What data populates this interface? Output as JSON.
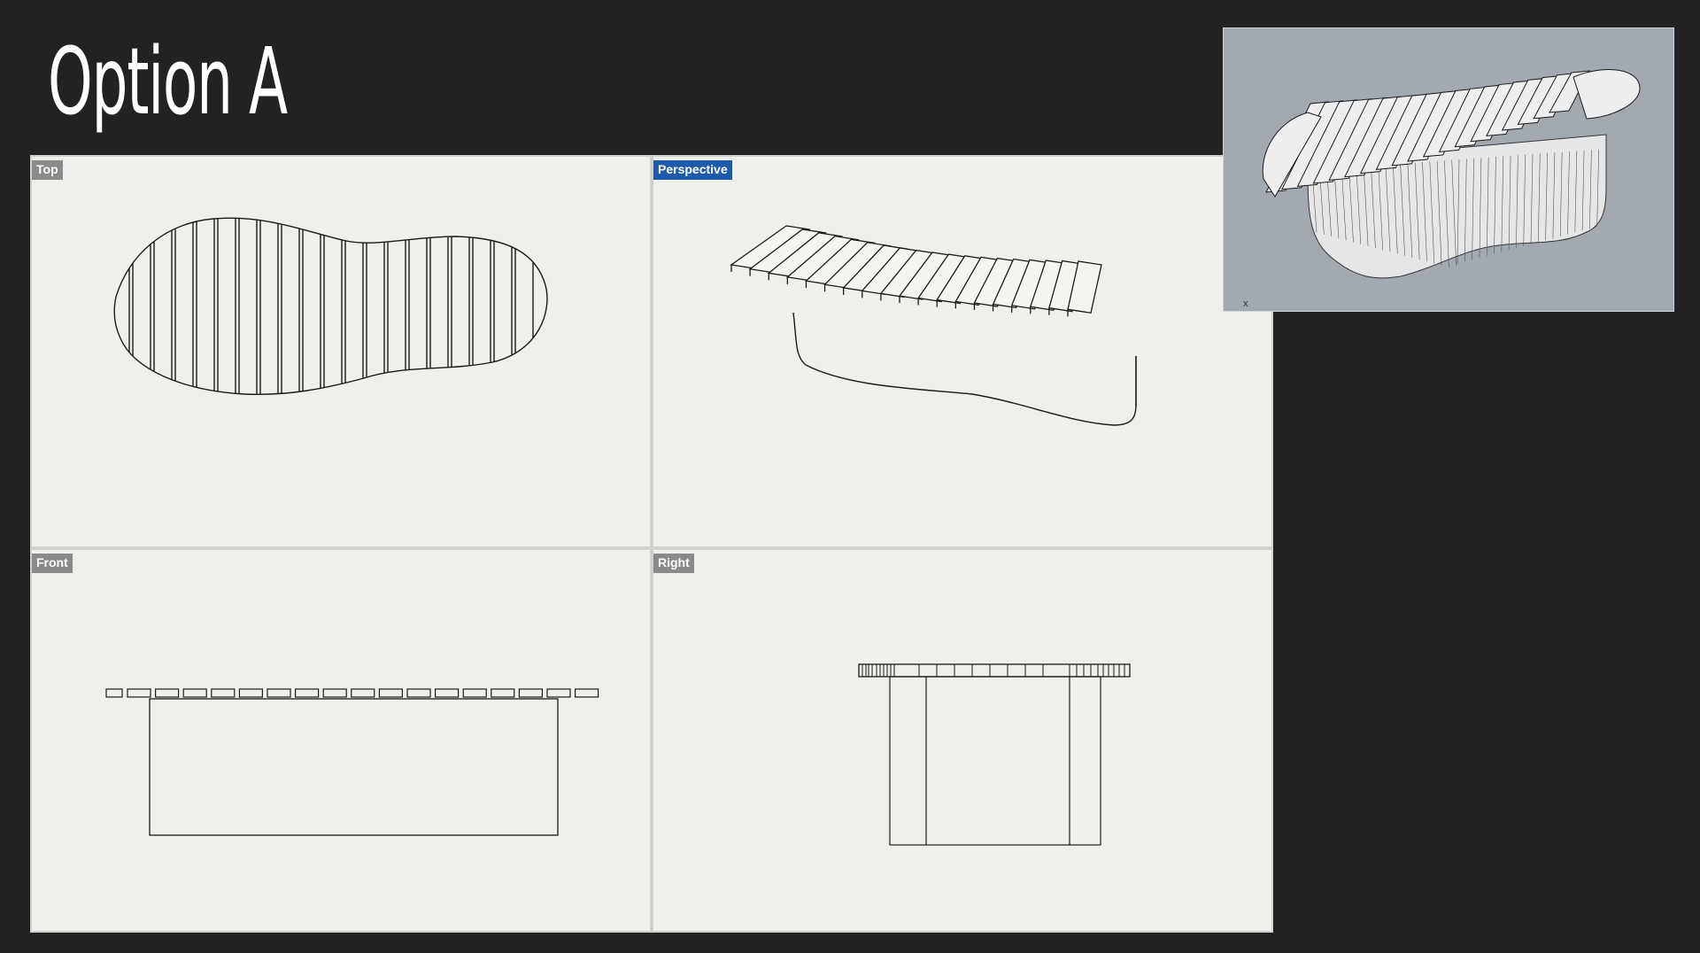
{
  "slide": {
    "title": "Option A"
  },
  "viewports": {
    "top": {
      "label": "Top"
    },
    "perspective": {
      "label": "Perspective"
    },
    "front": {
      "label": "Front"
    },
    "right": {
      "label": "Right"
    }
  },
  "inset": {
    "axis_label": "x"
  },
  "colors": {
    "background": "#222222",
    "viewport_bg": "#efefeb",
    "label_inactive": "#8a8a8a",
    "label_active": "#1e5ba8",
    "inset_bg": "#a3a9b0"
  }
}
